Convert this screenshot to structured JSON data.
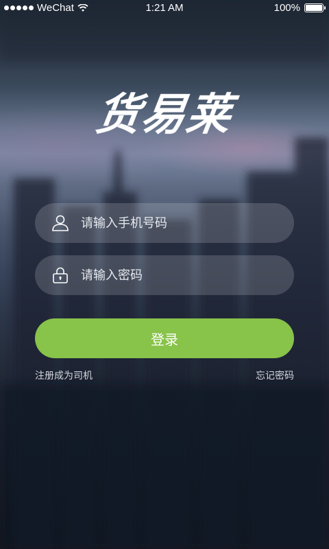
{
  "status_bar": {
    "carrier": "WeChat",
    "time": "1:21 AM",
    "battery": "100%",
    "battery_level": 1.0
  },
  "app": {
    "logo_text": "货易莱"
  },
  "login_form": {
    "phone_placeholder": "请输入手机号码",
    "password_placeholder": "请输入密码",
    "login_label": "登录",
    "register_link": "注册成为司机",
    "forgot_link": "忘记密码"
  },
  "icons": {
    "user": "user-icon",
    "lock": "lock-icon",
    "wifi": "wifi-icon"
  },
  "colors": {
    "accent": "#88c34a"
  }
}
